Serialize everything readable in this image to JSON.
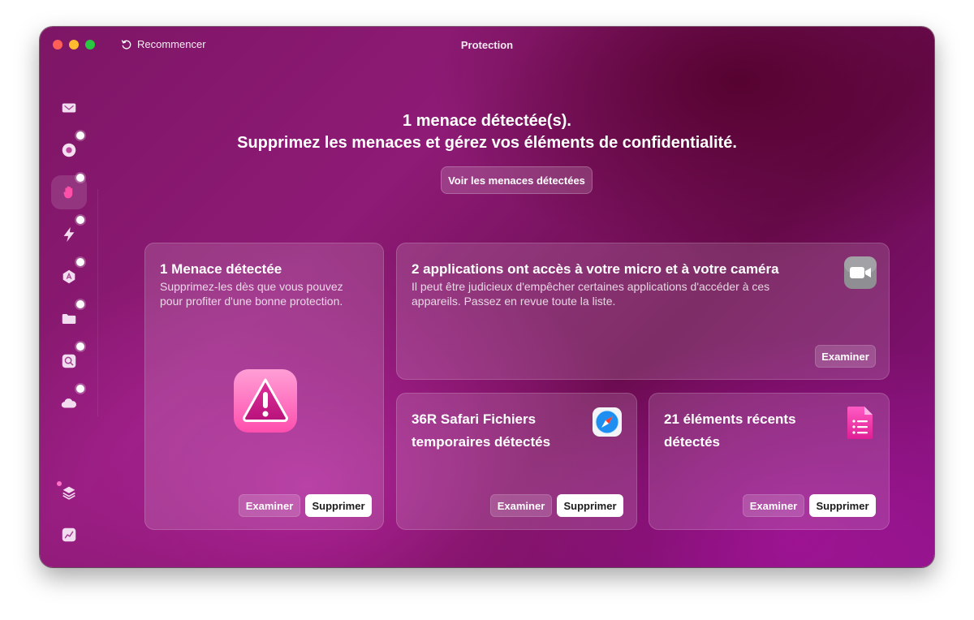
{
  "window": {
    "title": "Protection",
    "restart_label": "Recommencer"
  },
  "header": {
    "headline": "1 menace détectée(s).",
    "subline": "Supprimez les menaces et gérez vos éléments de confidentialité.",
    "view_threats_label": "Voir les menaces détectées"
  },
  "sidebar": {
    "items": [
      {
        "icon": "disk-cleanup-icon"
      },
      {
        "icon": "protection-scan-icon"
      },
      {
        "icon": "hand-stop-icon",
        "active": true
      },
      {
        "icon": "speed-bolt-icon"
      },
      {
        "icon": "applications-icon"
      },
      {
        "icon": "folder-icon"
      },
      {
        "icon": "space-lens-icon"
      },
      {
        "icon": "cloud-icon"
      }
    ],
    "bottom_items": [
      {
        "icon": "layers-icon"
      },
      {
        "icon": "activity-chart-icon"
      }
    ]
  },
  "cards": {
    "threat": {
      "title": "1 Menace détectée",
      "description": "Supprimez-les dès que vous pouvez pour profiter d'une bonne protection.",
      "review_label": "Examiner",
      "remove_label": "Supprimer",
      "icon": "warning-icon"
    },
    "permissions": {
      "title": "2 applications ont accès à votre micro et à votre caméra",
      "description": "Il peut être judicieux d'empêcher certaines applications d'accéder à ces appareils. Passez en revue toute la liste.",
      "review_label": "Examiner",
      "icon": "facetime-camera-icon"
    },
    "safari": {
      "title": "36R Safari Fichiers temporaires détectés",
      "review_label": "Examiner",
      "remove_label": "Supprimer",
      "icon": "safari-compass-icon"
    },
    "recent": {
      "title": "21 éléments récents détectés",
      "review_label": "Examiner",
      "remove_label": "Supprimer",
      "icon": "document-list-icon"
    }
  },
  "colors": {
    "accent_pink": "#ff4fa8",
    "window_bg": "#7e1565"
  }
}
